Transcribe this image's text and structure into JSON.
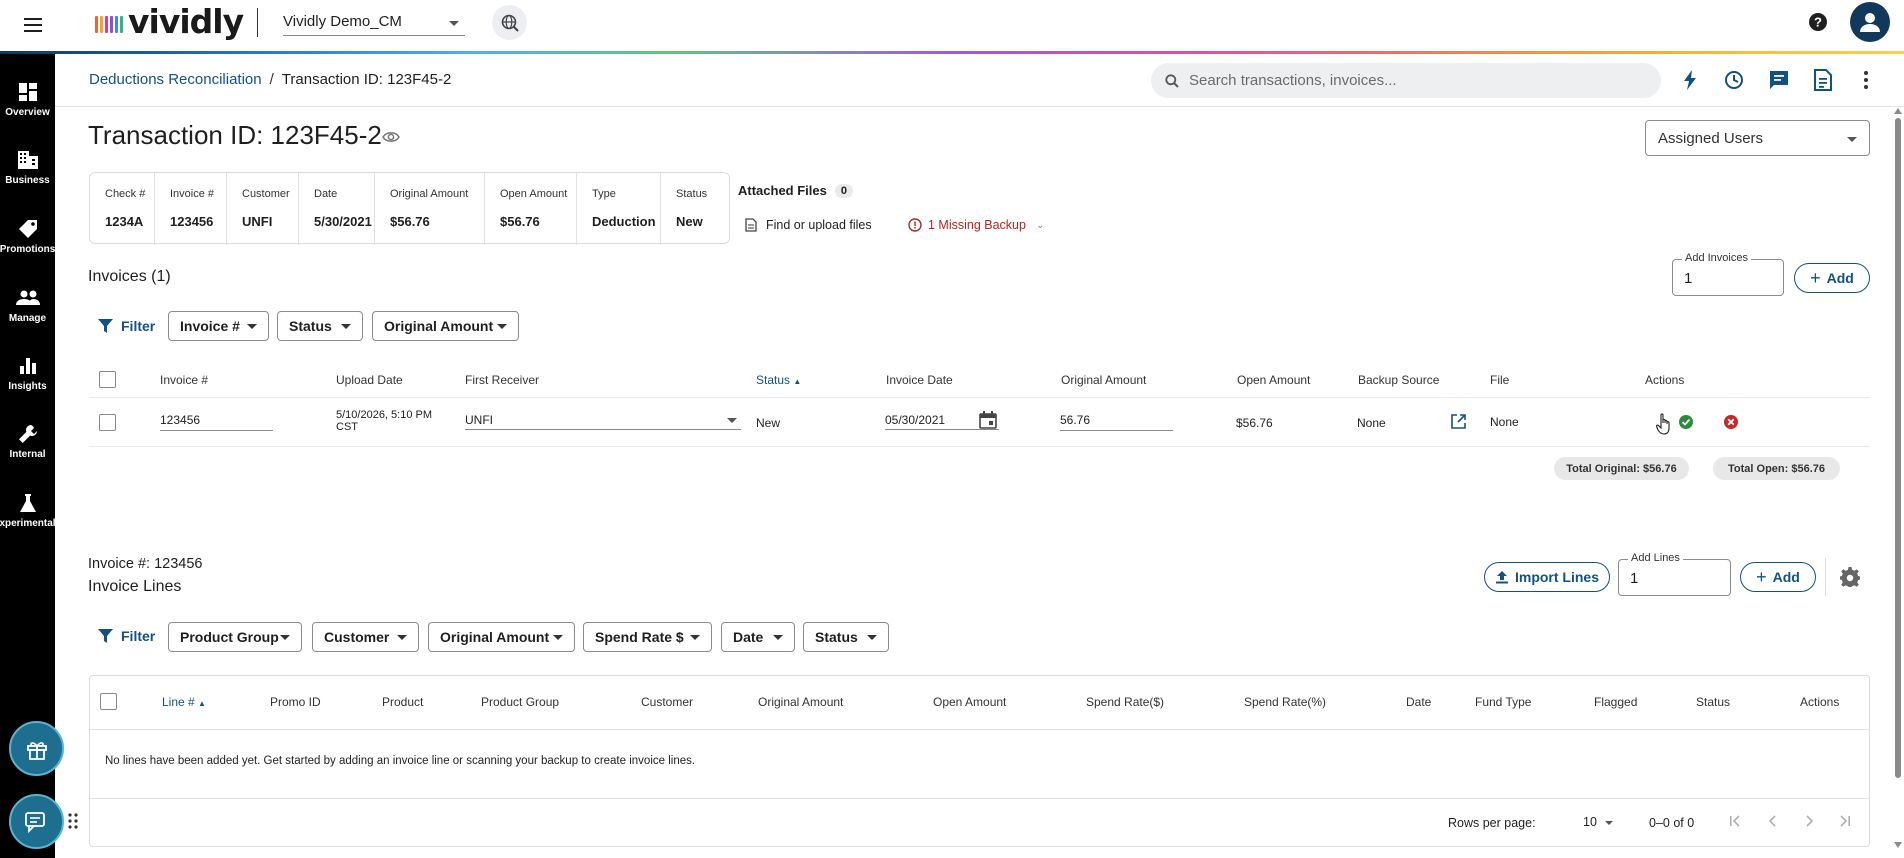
{
  "app": {
    "brand_name": "vividly",
    "brand_bar_colors": [
      "#f0642b",
      "#f5a623",
      "#d63aa5",
      "#8a4fd6",
      "#3a8ee0",
      "#36b37e"
    ],
    "org_selector": "Vividly Demo_CM",
    "accent_color": "#13527e"
  },
  "sidebar": {
    "items": [
      {
        "label": "Overview",
        "icon": "dashboard-icon"
      },
      {
        "label": "Business",
        "icon": "building-icon"
      },
      {
        "label": "Promotions",
        "icon": "tag-icon"
      },
      {
        "label": "Manage",
        "icon": "people-icon"
      },
      {
        "label": "Insights",
        "icon": "bar-chart-icon"
      },
      {
        "label": "Internal",
        "icon": "wrench-icon"
      },
      {
        "label": "xperimental",
        "icon": "flask-icon"
      }
    ]
  },
  "breadcrumb": {
    "parent": "Deductions Reconciliation",
    "separator": "/",
    "current": "Transaction ID: 123F45-2"
  },
  "search": {
    "placeholder": "Search transactions, invoices..."
  },
  "page": {
    "title": "Transaction ID: 123F45-2",
    "assigned_users": "Assigned Users"
  },
  "summary": {
    "check_label": "Check #",
    "check_value": "1234A",
    "invoice_label": "Invoice #",
    "invoice_value": "123456",
    "customer_label": "Customer",
    "customer_value": "UNFI",
    "date_label": "Date",
    "date_value": "5/30/2021",
    "original_label": "Original Amount",
    "original_value": "$56.76",
    "open_label": "Open Amount",
    "open_value": "$56.76",
    "type_label": "Type",
    "type_value": "Deduction",
    "status_label": "Status",
    "status_value": "New"
  },
  "attachments": {
    "label": "Attached Files",
    "count": "0",
    "find_upload": "Find or upload files",
    "missing_backup": "1 Missing Backup"
  },
  "invoices": {
    "title": "Invoices (1)",
    "add_field_label": "Add Invoices",
    "add_field_value": "1",
    "add_button": "Add",
    "filter_label": "Filter",
    "filters": [
      "Invoice #",
      "Status",
      "Original Amount"
    ],
    "columns": [
      "Invoice #",
      "Upload Date",
      "First Receiver",
      "Status",
      "Invoice Date",
      "Original Amount",
      "Open Amount",
      "Backup Source",
      "File",
      "Actions"
    ],
    "rows": [
      {
        "invoice_no": "123456",
        "upload_date_1": "5/10/2026, 5:10 PM",
        "upload_date_2": "CST",
        "first_receiver": "UNFI",
        "status": "New",
        "invoice_date": "05/30/2021",
        "original_amount": "56.76",
        "open_amount": "$56.76",
        "backup_source": "None",
        "file": "None"
      }
    ],
    "total_original": "Total Original: $56.76",
    "total_open": "Total Open: $56.76"
  },
  "invoice_lines": {
    "invoice_ref": "Invoice #: 123456",
    "title": "Invoice Lines",
    "import_button": "Import Lines",
    "add_field_label": "Add Lines",
    "add_field_value": "1",
    "add_button": "Add",
    "filter_label": "Filter",
    "filters": [
      "Product Group",
      "Customer",
      "Original Amount",
      "Spend Rate $",
      "Date",
      "Status"
    ],
    "columns": [
      "Line #",
      "Promo ID",
      "Product",
      "Product Group",
      "Customer",
      "Original Amount",
      "Open Amount",
      "Spend Rate($)",
      "Spend Rate(%)",
      "Date",
      "Fund Type",
      "Flagged",
      "Status",
      "Actions"
    ],
    "empty_message": "No lines have been added yet. Get started by adding an invoice line or scanning your backup to create invoice lines.",
    "rows_per_page_label": "Rows per page:",
    "rows_per_page_value": "10",
    "range": "0–0 of 0"
  }
}
